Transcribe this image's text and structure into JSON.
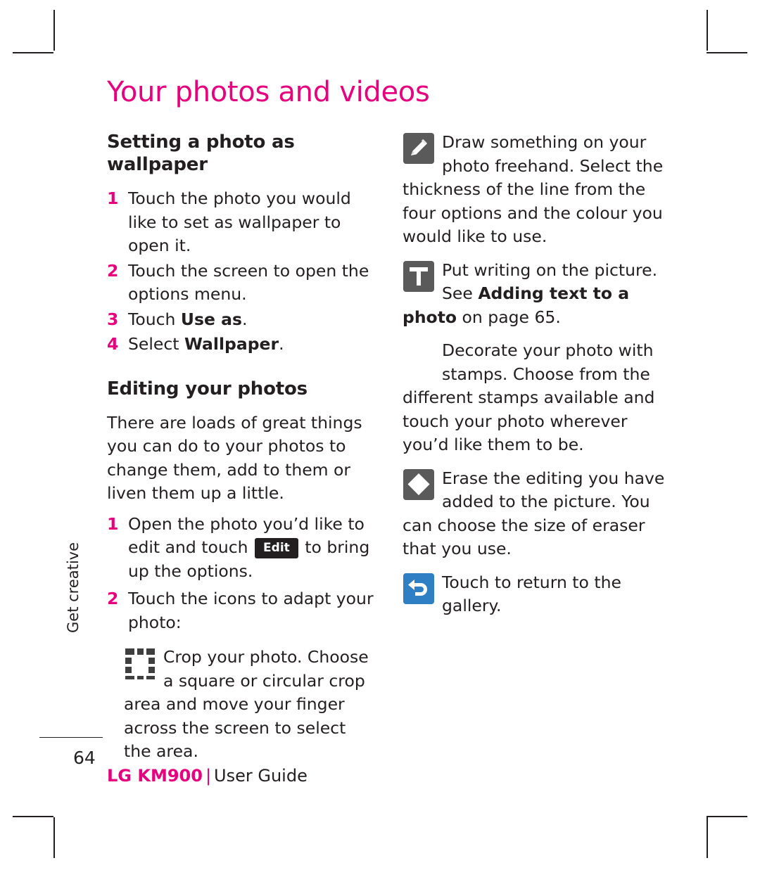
{
  "page": {
    "title": "Your photos and videos",
    "number": "64",
    "side_text": "Get creative",
    "footer": {
      "brand": "LG KM900",
      "separator": "|",
      "guide": "User Guide"
    }
  },
  "left_column": {
    "section1": {
      "heading": "Setting a photo as wallpaper",
      "steps": [
        {
          "num": "1",
          "text": "Touch the photo you would like to set as wallpaper to open it."
        },
        {
          "num": "2",
          "text": "Touch the screen to open the options menu."
        },
        {
          "num": "3",
          "text_before": "Touch ",
          "bold": "Use as",
          "text_after": "."
        },
        {
          "num": "4",
          "text_before": "Select ",
          "bold": "Wallpaper",
          "text_after": "."
        }
      ]
    },
    "section2": {
      "heading": "Editing your photos",
      "intro": "There are loads of great things you can do to your photos to change them, add to them or liven them up a little.",
      "steps": [
        {
          "num": "1",
          "text_before": "Open the photo you’d like to edit and touch ",
          "chip": "Edit",
          "text_after": " to bring up the options."
        },
        {
          "num": "2",
          "text": "Touch the icons to adapt your photo:"
        }
      ],
      "icon_items": [
        {
          "icon": "crop-icon",
          "text": "Crop your photo. Choose a square or circular crop area and move your finger across the screen to select the area."
        }
      ]
    }
  },
  "right_column": {
    "items": [
      {
        "icon": "pencil-icon",
        "text": "Draw something on your photo freehand. Select the thickness of the line from the four options and the colour you would like to use."
      },
      {
        "icon": "text-tool-icon",
        "text_before": "Put writing on the picture. See ",
        "bold": "Adding text to a photo",
        "text_after": " on page 65."
      },
      {
        "icon": "stamp-icon",
        "text": "Decorate your photo with stamps. Choose from the different stamps available and touch your photo wherever you’d like them to be."
      },
      {
        "icon": "eraser-icon",
        "text": "Erase the editing you have added to the picture. You can choose the size of eraser that you use."
      },
      {
        "icon": "undo-return-icon",
        "text": "Touch to return to the gallery."
      }
    ]
  },
  "colors": {
    "accent": "#e6007e",
    "text": "#231f20",
    "icon_fill": "#3f3f3f"
  }
}
